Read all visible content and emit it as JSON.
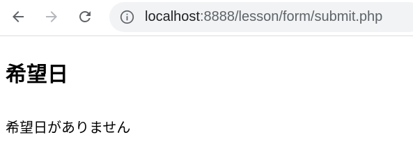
{
  "browser": {
    "back_icon": "arrow-left-icon",
    "forward_icon": "arrow-right-icon",
    "reload_icon": "reload-icon",
    "info_icon": "info-circle-icon",
    "url_host": "localhost",
    "url_rest": ":8888/lesson/form/submit.php",
    "colors": {
      "active_icon": "#5f6368",
      "disabled_icon": "#b4b7bb",
      "omnibox_bg": "#f1f3f4"
    }
  },
  "page": {
    "heading": "希望日",
    "message": "希望日がありません"
  }
}
